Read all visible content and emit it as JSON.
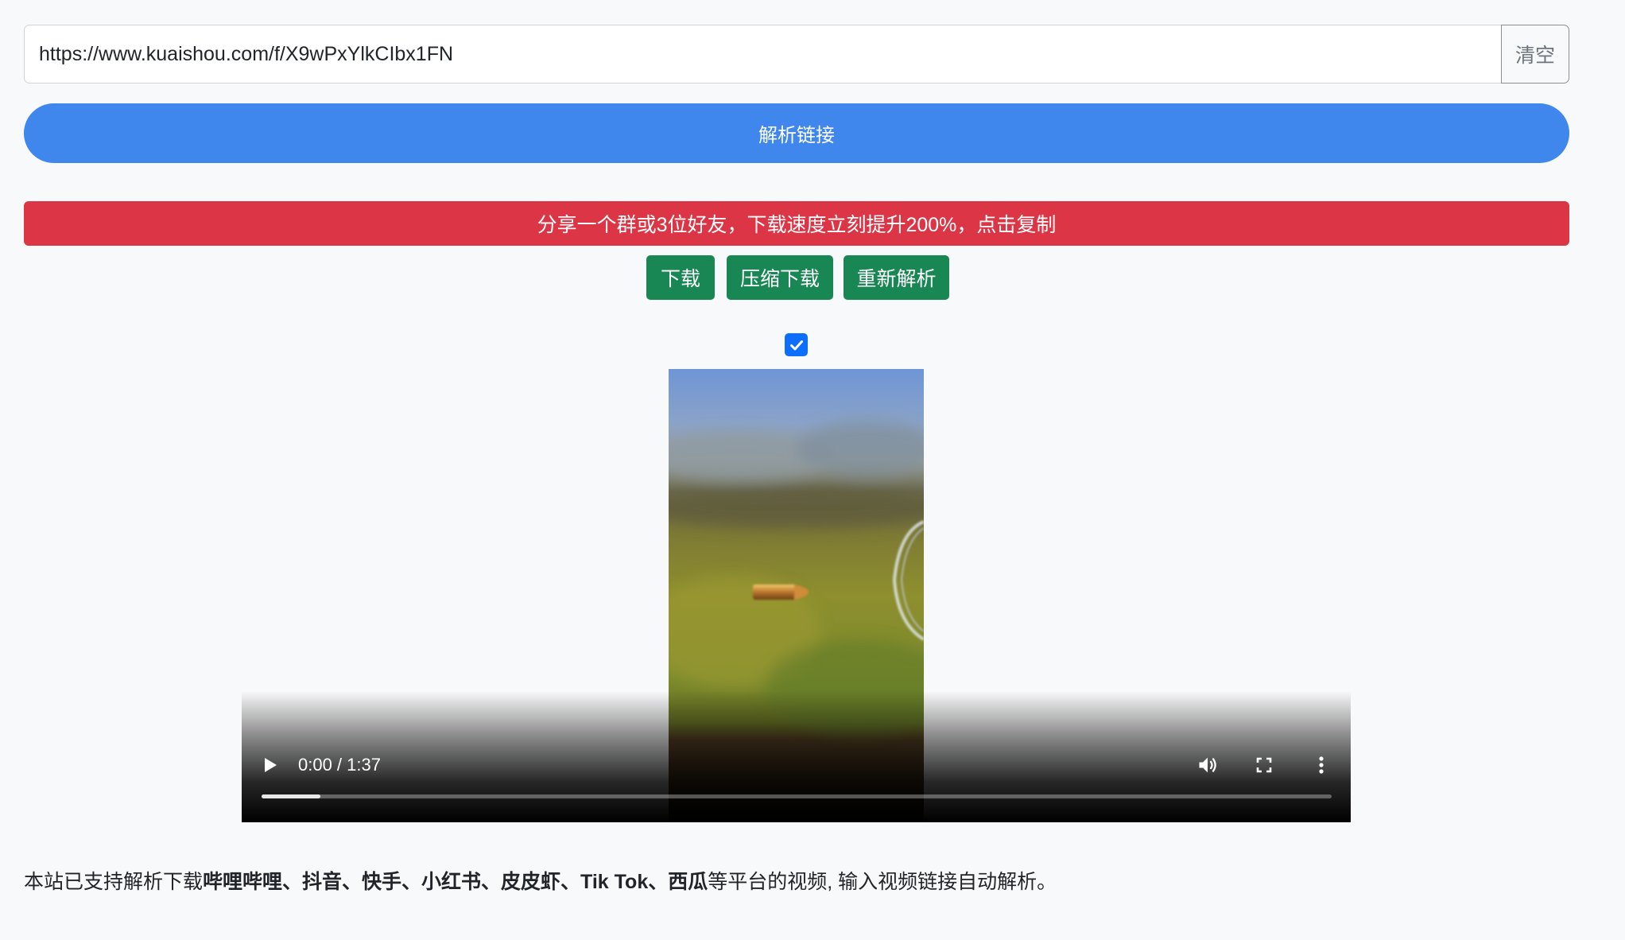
{
  "colors": {
    "page_bg": "#f8f9fa",
    "primary": "#3f87ed",
    "danger": "#dc3545",
    "success": "#198754",
    "checkbox": "#0d6efd"
  },
  "url_input": {
    "value": "https://www.kuaishou.com/f/X9wPxYlkCIbx1FN"
  },
  "clear_button": {
    "label": "清空"
  },
  "parse_button": {
    "label": "解析链接"
  },
  "share_banner": {
    "text": "分享一个群或3位好友，下载速度立刻提升200%，点击复制"
  },
  "actions": {
    "download": "下载",
    "compress_download": "压缩下载",
    "reparse": "重新解析"
  },
  "select_checkbox": {
    "checked": true
  },
  "video": {
    "time_display": "0:00 / 1:37",
    "played_fraction": 0,
    "buffered_fraction": 0.055,
    "icons": [
      "play-icon",
      "volume-icon",
      "fullscreen-icon",
      "more-options-icon"
    ]
  },
  "footer": {
    "prefix": "本站已支持解析下载",
    "platforms": "哔哩哔哩、抖音、快手、小红书、皮皮虾、Tik Tok、西瓜",
    "suffix": "等平台的视频, 输入视频链接自动解析。"
  }
}
